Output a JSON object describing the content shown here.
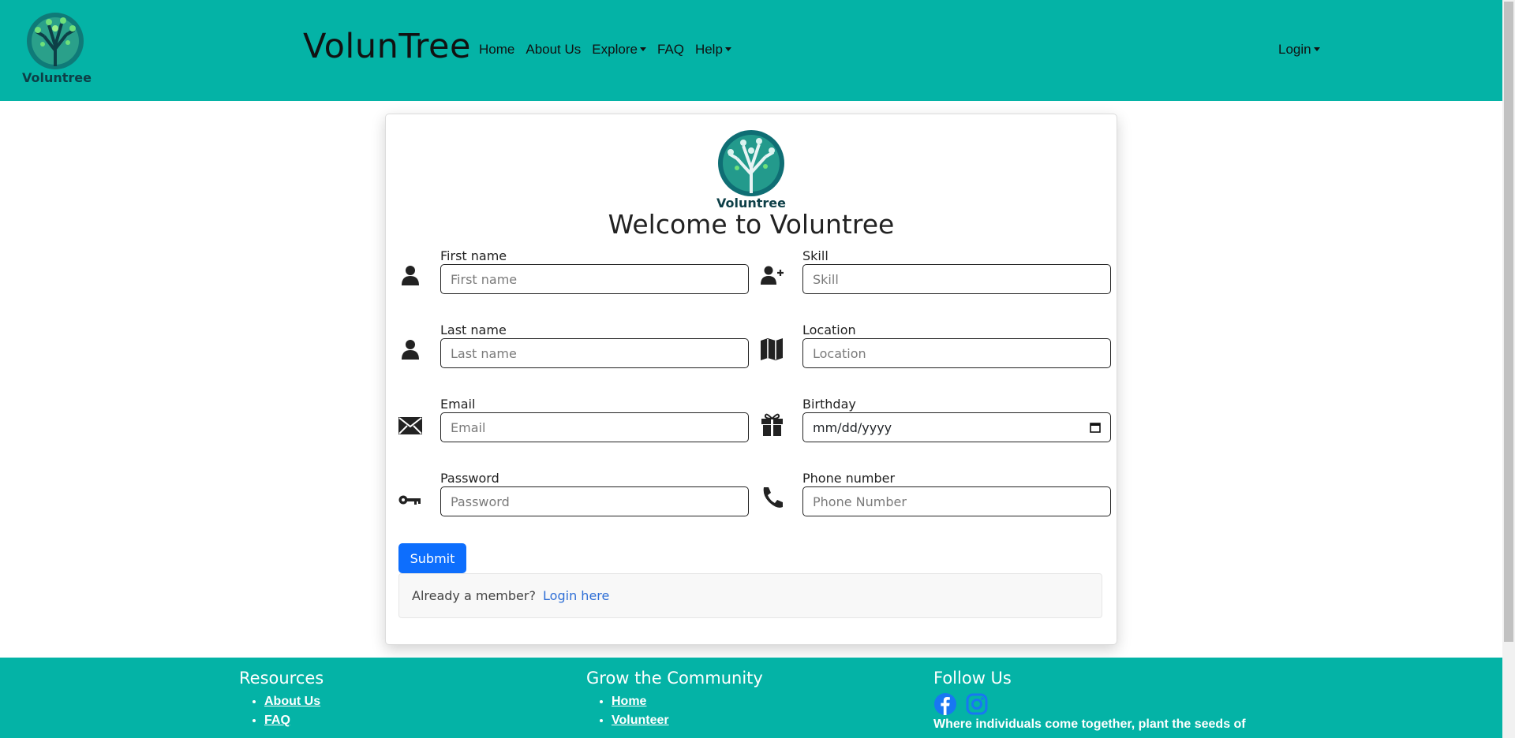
{
  "nav": {
    "brand": "VolunTree",
    "logo_text": "Voluntree",
    "links": [
      "Home",
      "About Us",
      "Explore",
      "FAQ",
      "Help"
    ],
    "login": "Login"
  },
  "card": {
    "logo_text": "Voluntree",
    "title": "Welcome to Voluntree",
    "fields": {
      "first_name": {
        "label": "First name",
        "placeholder": "First name",
        "icon": "person-icon"
      },
      "last_name": {
        "label": "Last name",
        "placeholder": "Last name",
        "icon": "person-icon"
      },
      "email": {
        "label": "Email",
        "placeholder": "Email",
        "icon": "envelope-icon"
      },
      "password": {
        "label": "Password",
        "placeholder": "Password",
        "icon": "key-icon"
      },
      "skill": {
        "label": "Skill",
        "placeholder": "Skill",
        "icon": "person-plus-icon"
      },
      "location": {
        "label": "Location",
        "placeholder": "Location",
        "icon": "map-icon"
      },
      "birthday": {
        "label": "Birthday",
        "value": "mm/dd/yyyy",
        "icon": "gift-icon"
      },
      "phone": {
        "label": "Phone number",
        "placeholder": "Phone Number",
        "icon": "phone-icon"
      }
    },
    "submit": "Submit",
    "member_prompt": "Already a member?",
    "member_link": "Login here"
  },
  "footer": {
    "resources": {
      "heading": "Resources",
      "links": [
        "About Us",
        "FAQ"
      ]
    },
    "community": {
      "heading": "Grow the Community",
      "links": [
        "Home",
        "Volunteer"
      ]
    },
    "follow": {
      "heading": "Follow Us",
      "icons": [
        "facebook-icon",
        "instagram-icon"
      ],
      "tagline": "Where individuals come together, plant the seeds of"
    }
  },
  "colors": {
    "brand": "#04b3a6",
    "primary": "#0d6efd",
    "link": "#2f6fd6"
  }
}
